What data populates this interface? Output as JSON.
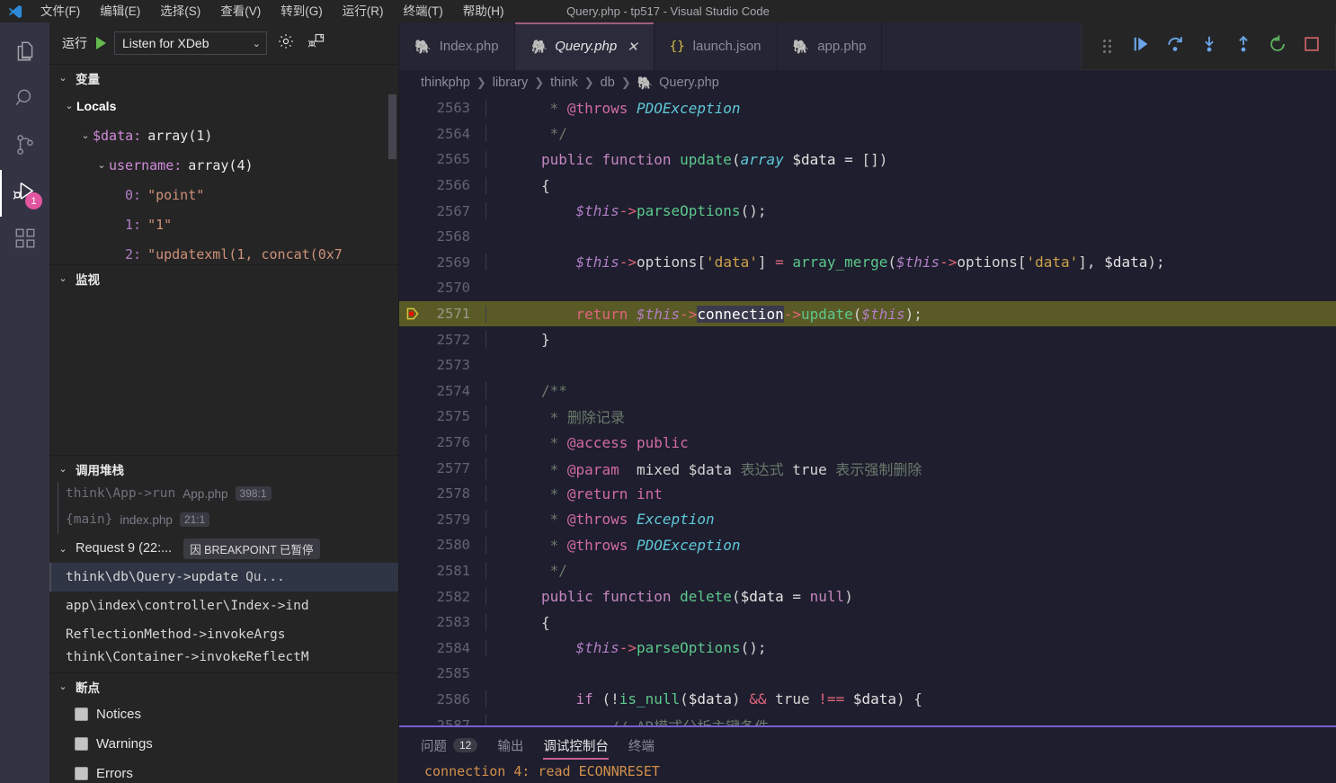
{
  "window": {
    "title": "Query.php - tp517 - Visual Studio Code",
    "menu": [
      "文件(F)",
      "编辑(E)",
      "选择(S)",
      "查看(V)",
      "转到(G)",
      "运行(R)",
      "终端(T)",
      "帮助(H)"
    ]
  },
  "activitybar": {
    "items": [
      {
        "name": "explorer",
        "icon": "files-icon"
      },
      {
        "name": "search",
        "icon": "search-icon"
      },
      {
        "name": "source-control",
        "icon": "source-control-icon"
      },
      {
        "name": "run-debug",
        "icon": "run-debug-icon",
        "badge": "1"
      },
      {
        "name": "extensions",
        "icon": "extensions-icon"
      }
    ]
  },
  "debug_sidebar": {
    "run_label": "运行",
    "configuration": "Listen for XDeb",
    "gear_tooltip": "配置",
    "sections": {
      "variables": {
        "title": "变量",
        "rows": [
          {
            "indent": 0,
            "twisty": "⌄",
            "name": "Locals",
            "kind": "scope"
          },
          {
            "indent": 1,
            "twisty": "⌄",
            "name": "$data:",
            "value": "array(1)",
            "kind": "var"
          },
          {
            "indent": 2,
            "twisty": "⌄",
            "name": "username:",
            "value": "array(4)",
            "kind": "var"
          },
          {
            "indent": 3,
            "twisty": "",
            "name": "0:",
            "value": "\"point\"",
            "kind": "entry"
          },
          {
            "indent": 3,
            "twisty": "",
            "name": "1:",
            "value": "\"1\"",
            "kind": "entry"
          },
          {
            "indent": 3,
            "twisty": "",
            "name": "2:",
            "value": "\"updatexml(1, concat(0x7",
            "kind": "entry"
          }
        ]
      },
      "watch": {
        "title": "监视",
        "rows": []
      },
      "callstack": {
        "title": "调用堆栈",
        "rows": [
          {
            "label": "think\\App->run",
            "file": "App.php",
            "pos": "398:1",
            "state": "dim"
          },
          {
            "label": "{main}",
            "file": "index.php",
            "pos": "21:1",
            "state": "dim"
          },
          {
            "label": "Request 9 (22:...",
            "badge": "因 BREAKPOINT 已暂停",
            "state": "session"
          },
          {
            "label": "think\\db\\Query->update",
            "file": "Qu...",
            "state": "selected"
          },
          {
            "label": "app\\index\\controller\\Index->ind",
            "file": "",
            "state": "normal"
          },
          {
            "label": "ReflectionMethod->invokeArgs",
            "file": "",
            "state": "normal"
          },
          {
            "label": "think\\Container->invokeReflectM",
            "file": "",
            "state": "clipped"
          }
        ]
      },
      "breakpoints": {
        "title": "断点",
        "rows": [
          {
            "label": "Notices",
            "checked": false
          },
          {
            "label": "Warnings",
            "checked": false
          },
          {
            "label": "Errors",
            "checked": false
          }
        ]
      }
    }
  },
  "editor": {
    "tabs": [
      {
        "label": "Index.php",
        "icon": "php-icon",
        "active": false,
        "closable": false
      },
      {
        "label": "Query.php",
        "icon": "php-icon",
        "active": true,
        "closable": true
      },
      {
        "label": "launch.json",
        "icon": "json-icon",
        "active": false,
        "closable": false
      },
      {
        "label": "app.php",
        "icon": "php-icon",
        "active": false,
        "closable": false
      }
    ],
    "close_glyph": "✕",
    "breadcrumb": [
      "thinkphp",
      "library",
      "think",
      "db",
      "Query.php"
    ],
    "breadcrumb_sep": "❯",
    "debug_toolbar": [
      {
        "name": "drag-handle",
        "icon": "grip-icon"
      },
      {
        "name": "continue",
        "icon": "continue-icon",
        "color": "#6ba6e8"
      },
      {
        "name": "step-over",
        "icon": "step-over-icon",
        "color": "#6ba6e8"
      },
      {
        "name": "step-into",
        "icon": "step-into-icon",
        "color": "#6ba6e8"
      },
      {
        "name": "step-out",
        "icon": "step-out-icon",
        "color": "#6ba6e8"
      },
      {
        "name": "restart",
        "icon": "restart-icon",
        "color": "#5fb25f"
      },
      {
        "name": "stop",
        "icon": "stop-icon",
        "color": "#c06060"
      }
    ],
    "current_line": 2571,
    "breakpoint_line": 2571,
    "lines": [
      {
        "n": 2563,
        "tokens": [
          {
            "t": " * ",
            "c": "t-cmt"
          },
          {
            "t": "@throws ",
            "c": "t-doc"
          },
          {
            "t": "PDOException",
            "c": "t-type"
          }
        ]
      },
      {
        "n": 2564,
        "tokens": [
          {
            "t": " */",
            "c": "t-cmt"
          }
        ]
      },
      {
        "n": 2565,
        "tokens": [
          {
            "t": "public ",
            "c": "t-kw"
          },
          {
            "t": "function ",
            "c": "t-kw"
          },
          {
            "t": "update",
            "c": "t-call"
          },
          {
            "t": "(",
            "c": "t-plain"
          },
          {
            "t": "array ",
            "c": "t-type"
          },
          {
            "t": "$data",
            "c": "t-var2"
          },
          {
            "t": " = ",
            "c": "t-plain"
          },
          {
            "t": "[])",
            "c": "t-plain"
          }
        ]
      },
      {
        "n": 2566,
        "tokens": [
          {
            "t": "{",
            "c": "t-plain"
          }
        ]
      },
      {
        "n": 2567,
        "tokens": [
          {
            "t": "    ",
            "c": "t-plain"
          },
          {
            "t": "$this",
            "c": "t-var"
          },
          {
            "t": "->",
            "c": "t-op"
          },
          {
            "t": "parseOptions",
            "c": "t-call"
          },
          {
            "t": "();",
            "c": "t-plain"
          }
        ]
      },
      {
        "n": 2568,
        "tokens": []
      },
      {
        "n": 2569,
        "tokens": [
          {
            "t": "    ",
            "c": "t-plain"
          },
          {
            "t": "$this",
            "c": "t-var"
          },
          {
            "t": "->",
            "c": "t-op"
          },
          {
            "t": "options",
            "c": "t-plain"
          },
          {
            "t": "[",
            "c": "t-plain"
          },
          {
            "t": "'data'",
            "c": "t-str"
          },
          {
            "t": "] ",
            "c": "t-plain"
          },
          {
            "t": "= ",
            "c": "t-op"
          },
          {
            "t": "array_merge",
            "c": "t-call"
          },
          {
            "t": "(",
            "c": "t-plain"
          },
          {
            "t": "$this",
            "c": "t-var"
          },
          {
            "t": "->",
            "c": "t-op"
          },
          {
            "t": "options",
            "c": "t-plain"
          },
          {
            "t": "[",
            "c": "t-plain"
          },
          {
            "t": "'data'",
            "c": "t-str"
          },
          {
            "t": "], ",
            "c": "t-plain"
          },
          {
            "t": "$data",
            "c": "t-var2"
          },
          {
            "t": ");",
            "c": "t-plain"
          }
        ]
      },
      {
        "n": 2570,
        "tokens": []
      },
      {
        "n": 2571,
        "tokens": [
          {
            "t": "    ",
            "c": "t-plain"
          },
          {
            "t": "return ",
            "c": "t-op"
          },
          {
            "t": "$this",
            "c": "t-var"
          },
          {
            "t": "->",
            "c": "t-op"
          },
          {
            "t": "connection",
            "c": "t-sel"
          },
          {
            "t": "->",
            "c": "t-op"
          },
          {
            "t": "update",
            "c": "t-call"
          },
          {
            "t": "(",
            "c": "t-plain"
          },
          {
            "t": "$this",
            "c": "t-var"
          },
          {
            "t": ");",
            "c": "t-plain"
          }
        ]
      },
      {
        "n": 2572,
        "tokens": [
          {
            "t": "}",
            "c": "t-plain"
          }
        ]
      },
      {
        "n": 2573,
        "tokens": []
      },
      {
        "n": 2574,
        "tokens": [
          {
            "t": "/**",
            "c": "t-cmt"
          }
        ]
      },
      {
        "n": 2575,
        "tokens": [
          {
            "t": " * 删除记录",
            "c": "t-cmt"
          }
        ]
      },
      {
        "n": 2576,
        "tokens": [
          {
            "t": " * ",
            "c": "t-cmt"
          },
          {
            "t": "@access ",
            "c": "t-doc"
          },
          {
            "t": "public",
            "c": "t-doc"
          }
        ]
      },
      {
        "n": 2577,
        "tokens": [
          {
            "t": " * ",
            "c": "t-cmt"
          },
          {
            "t": "@param ",
            "c": "t-doc"
          },
          {
            "t": " mixed ",
            "c": "t-plain"
          },
          {
            "t": "$data",
            "c": "t-plain"
          },
          {
            "t": " 表达式 ",
            "c": "t-cmt"
          },
          {
            "t": "true",
            "c": "t-plain"
          },
          {
            "t": " 表示强制删除",
            "c": "t-cmt"
          }
        ]
      },
      {
        "n": 2578,
        "tokens": [
          {
            "t": " * ",
            "c": "t-cmt"
          },
          {
            "t": "@return ",
            "c": "t-doc"
          },
          {
            "t": "int",
            "c": "t-doc"
          }
        ]
      },
      {
        "n": 2579,
        "tokens": [
          {
            "t": " * ",
            "c": "t-cmt"
          },
          {
            "t": "@throws ",
            "c": "t-doc"
          },
          {
            "t": "Exception",
            "c": "t-type"
          }
        ]
      },
      {
        "n": 2580,
        "tokens": [
          {
            "t": " * ",
            "c": "t-cmt"
          },
          {
            "t": "@throws ",
            "c": "t-doc"
          },
          {
            "t": "PDOException",
            "c": "t-type"
          }
        ]
      },
      {
        "n": 2581,
        "tokens": [
          {
            "t": " */",
            "c": "t-cmt"
          }
        ]
      },
      {
        "n": 2582,
        "tokens": [
          {
            "t": "public ",
            "c": "t-kw"
          },
          {
            "t": "function ",
            "c": "t-kw"
          },
          {
            "t": "delete",
            "c": "t-call"
          },
          {
            "t": "(",
            "c": "t-plain"
          },
          {
            "t": "$data",
            "c": "t-var2"
          },
          {
            "t": " = ",
            "c": "t-plain"
          },
          {
            "t": "null",
            "c": "t-null"
          },
          {
            "t": ")",
            "c": "t-plain"
          }
        ]
      },
      {
        "n": 2583,
        "tokens": [
          {
            "t": "{",
            "c": "t-plain"
          }
        ]
      },
      {
        "n": 2584,
        "tokens": [
          {
            "t": "    ",
            "c": "t-plain"
          },
          {
            "t": "$this",
            "c": "t-var"
          },
          {
            "t": "->",
            "c": "t-op"
          },
          {
            "t": "parseOptions",
            "c": "t-call"
          },
          {
            "t": "();",
            "c": "t-plain"
          }
        ]
      },
      {
        "n": 2585,
        "tokens": []
      },
      {
        "n": 2586,
        "tokens": [
          {
            "t": "    ",
            "c": "t-plain"
          },
          {
            "t": "if ",
            "c": "t-kw"
          },
          {
            "t": "(!",
            "c": "t-plain"
          },
          {
            "t": "is_null",
            "c": "t-call"
          },
          {
            "t": "(",
            "c": "t-plain"
          },
          {
            "t": "$data",
            "c": "t-var2"
          },
          {
            "t": ") ",
            "c": "t-plain"
          },
          {
            "t": "&& ",
            "c": "t-op"
          },
          {
            "t": "true ",
            "c": "t-plain"
          },
          {
            "t": "!== ",
            "c": "t-op"
          },
          {
            "t": "$data",
            "c": "t-var2"
          },
          {
            "t": ") {",
            "c": "t-plain"
          }
        ]
      },
      {
        "n": 2587,
        "tokens": [
          {
            "t": "        // AR模式分析主键条件",
            "c": "t-cmt"
          }
        ]
      }
    ]
  },
  "panel": {
    "tabs": [
      {
        "label": "问题",
        "badge": "12",
        "active": false
      },
      {
        "label": "输出",
        "badge": "",
        "active": false
      },
      {
        "label": "调试控制台",
        "badge": "",
        "active": true
      },
      {
        "label": "终端",
        "badge": "",
        "active": false
      }
    ],
    "console_output": "connection 4: read ECONNRESET"
  },
  "colors": {
    "accent_pink": "#e255a1",
    "panel_border": "#7a5fd0",
    "tab_active_top": "#a05b7a",
    "exec_line": "#5a5a27",
    "breakpoint_red": "#e51400"
  }
}
